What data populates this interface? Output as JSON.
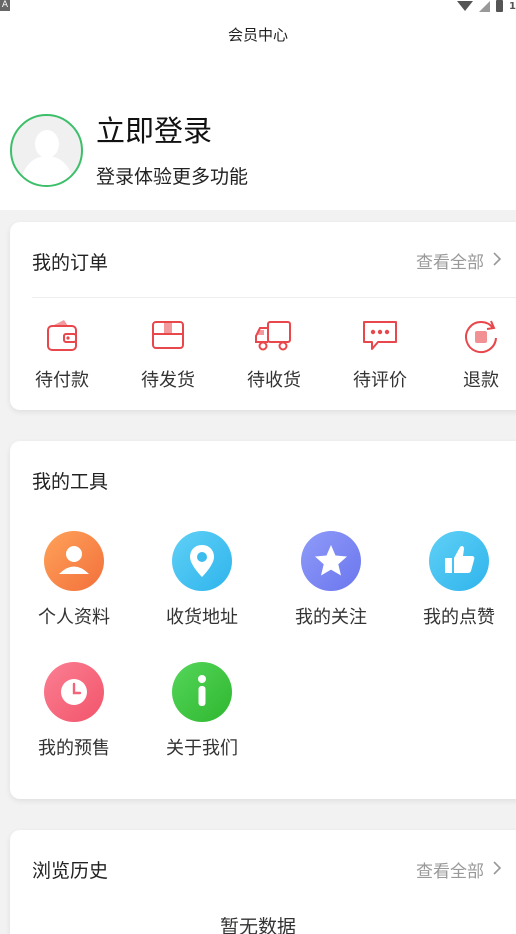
{
  "header": {
    "title": "会员中心"
  },
  "profile": {
    "login_title": "立即登录",
    "login_sub": "登录体验更多功能"
  },
  "orders": {
    "title": "我的订单",
    "view_all": "查看全部",
    "items": [
      {
        "label": "待付款",
        "icon": "wallet-icon"
      },
      {
        "label": "待发货",
        "icon": "package-icon"
      },
      {
        "label": "待收货",
        "icon": "truck-icon"
      },
      {
        "label": "待评价",
        "icon": "comment-icon"
      },
      {
        "label": "退款",
        "icon": "refund-icon"
      }
    ]
  },
  "tools": {
    "title": "我的工具",
    "items": [
      {
        "label": "个人资料",
        "icon": "person-icon"
      },
      {
        "label": "收货地址",
        "icon": "location-icon"
      },
      {
        "label": "我的关注",
        "icon": "star-icon"
      },
      {
        "label": "我的点赞",
        "icon": "thumbs-up-icon"
      },
      {
        "label": "我的预售",
        "icon": "clock-icon"
      },
      {
        "label": "关于我们",
        "icon": "info-icon"
      }
    ]
  },
  "history": {
    "title": "浏览历史",
    "view_all": "查看全部",
    "empty": "暂无数据"
  },
  "colors": {
    "accent_red": "#e8474c",
    "avatar_ring": "#3dbf6a",
    "muted_text": "#999999"
  }
}
